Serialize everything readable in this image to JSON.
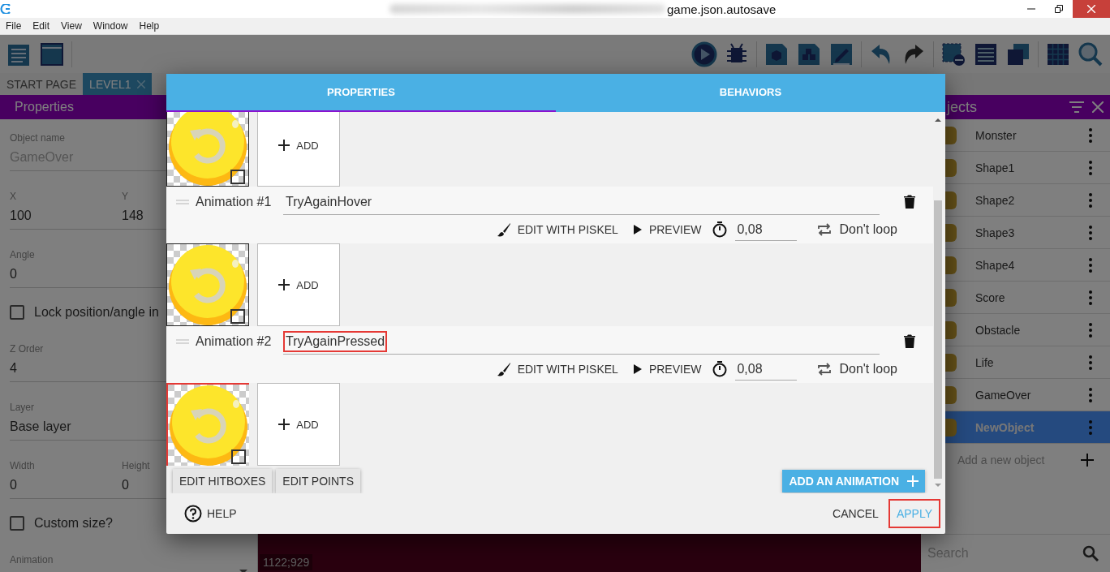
{
  "window": {
    "title": "game.json.autosave"
  },
  "menu": [
    "File",
    "Edit",
    "View",
    "Window",
    "Help"
  ],
  "editor_tabs": [
    {
      "label": "START PAGE",
      "selected": false
    },
    {
      "label": "LEVEL1",
      "selected": true
    }
  ],
  "properties_panel": {
    "title": "Properties",
    "fields": [
      {
        "kind": "text",
        "label": "Object name",
        "value": "GameOver",
        "disabled": true
      },
      {
        "kind": "pair",
        "items": [
          {
            "label": "X",
            "value": "100"
          },
          {
            "label": "Y",
            "value": "148"
          }
        ]
      },
      {
        "kind": "text",
        "label": "Angle",
        "value": "0",
        "disabled": false
      },
      {
        "kind": "checkbox",
        "label": "Lock position/angle in",
        "checked": false
      },
      {
        "kind": "text",
        "label": "Z Order",
        "value": "4",
        "disabled": false
      },
      {
        "kind": "text",
        "label": "Layer",
        "value": "Base layer",
        "disabled": false
      },
      {
        "kind": "pair",
        "items": [
          {
            "label": "Width",
            "value": "0"
          },
          {
            "label": "Height",
            "value": "0"
          }
        ]
      },
      {
        "kind": "checkbox",
        "label": "Custom size?",
        "checked": false
      },
      {
        "kind": "select",
        "label": "Animation"
      }
    ]
  },
  "canvas": {
    "coordinates": "1122;929"
  },
  "objects_panel": {
    "title": "jects",
    "items": [
      {
        "name": "Monster",
        "selected": false
      },
      {
        "name": "Shape1",
        "selected": false
      },
      {
        "name": "Shape2",
        "selected": false
      },
      {
        "name": "Shape3",
        "selected": false
      },
      {
        "name": "Shape4",
        "selected": false
      },
      {
        "name": "Score",
        "selected": false
      },
      {
        "name": "Obstacle",
        "selected": false
      },
      {
        "name": "Life",
        "selected": false
      },
      {
        "name": "GameOver",
        "selected": false
      },
      {
        "name": "NewObject",
        "selected": true
      }
    ],
    "add_label": "Add a new object",
    "search_placeholder": "Search"
  },
  "dialog": {
    "tabs": [
      {
        "label": "PROPERTIES",
        "selected": true
      },
      {
        "label": "BEHAVIORS",
        "selected": false
      }
    ],
    "sections": [
      {
        "kind": "frames",
        "highlighted": false,
        "add_label": "ADD"
      },
      {
        "kind": "animation",
        "label": "Animation #1",
        "name": "TryAgainHover",
        "highlighted": false,
        "edit_label": "EDIT WITH PISKEL",
        "preview_label": "PREVIEW",
        "duration": "0,08",
        "loop_label": "Don't loop"
      },
      {
        "kind": "frames",
        "highlighted": false,
        "add_label": "ADD"
      },
      {
        "kind": "animation",
        "label": "Animation #2",
        "name": "TryAgainPressed",
        "highlighted": true,
        "edit_label": "EDIT WITH PISKEL",
        "preview_label": "PREVIEW",
        "duration": "0,08",
        "loop_label": "Don't loop"
      },
      {
        "kind": "frames",
        "highlighted": true,
        "add_label": "ADD"
      }
    ],
    "tool_buttons": [
      "EDIT HITBOXES",
      "EDIT POINTS"
    ],
    "add_animation": "ADD AN ANIMATION",
    "help": "HELP",
    "actions": [
      {
        "label": "CANCEL",
        "primary": false,
        "highlighted": false
      },
      {
        "label": "APPLY",
        "primary": true,
        "highlighted": true
      }
    ]
  }
}
